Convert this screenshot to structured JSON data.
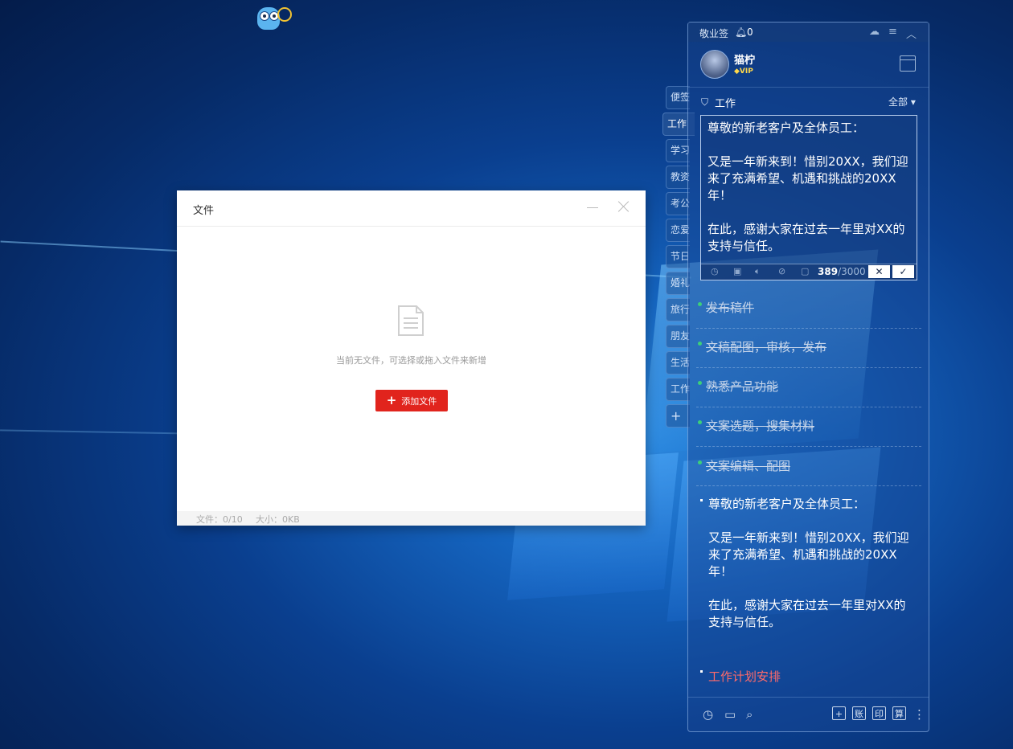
{
  "dialog": {
    "title": "文件",
    "empty_text": "当前无文件，可选择或拖入文件来新增",
    "add_button": "添加文件",
    "footer_files": "文件：0/10",
    "footer_size": "大小：0KB"
  },
  "side_tabs": [
    "便签",
    "工作",
    "学习",
    "教资",
    "考公",
    "恋爱",
    "节日",
    "婚礼",
    "旅行",
    "朋友",
    "生活",
    "工作",
    "+"
  ],
  "panel": {
    "app_name": "敬业签",
    "notification_count": "0",
    "user_name": "猫柠",
    "vip_label": "VIP",
    "category_name": "工作",
    "filter_label": "全部 ▾",
    "editor_text": "尊敬的新老客户及全体员工：\n\n又是一年新来到！惜别20XX，我们迎来了充满希望、机遇和挑战的20XX年！\n\n在此，感谢大家在过去一年里对XX的支持与信任。",
    "char_count": "389",
    "char_limit": "/3000",
    "done_items": [
      "发布稿件",
      "文稿配图，审核，发布",
      "熟悉产品功能",
      "文案选题，搜集材料",
      "文案编辑、配图"
    ],
    "note_text": "尊敬的新老客户及全体员工：\n\n又是一年新来到！惜别20XX，我们迎来了充满希望、机遇和挑战的20XX年！\n\n在此，感谢大家在过去一年里对XX的支持与信任。",
    "plan_item": "工作计划安排",
    "bottom_buttons": [
      "+",
      "账",
      "印",
      "算"
    ]
  },
  "icons": {
    "editor_toolbar": [
      "clock-icon",
      "image-icon",
      "audio-icon",
      "attachment-icon",
      "frame-icon"
    ],
    "bottom_left": [
      "clock-icon",
      "archive-icon",
      "search-icon"
    ]
  },
  "colors": {
    "accent_red": "#e1241d",
    "done_dot": "#3ccf7a",
    "plan_text": "#ff6a6a"
  }
}
